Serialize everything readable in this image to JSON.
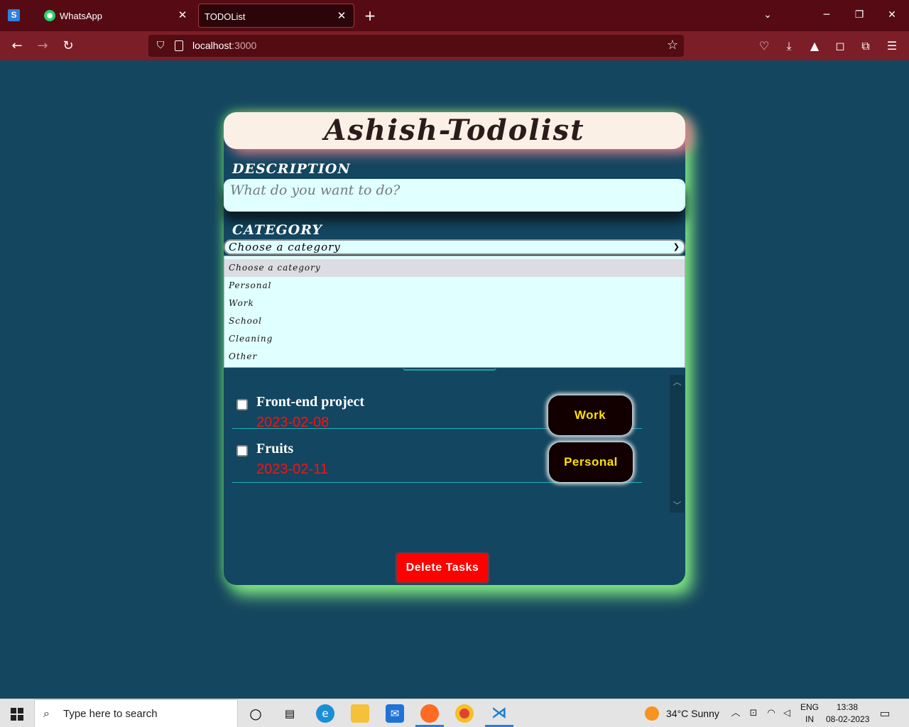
{
  "browser": {
    "tabs": [
      {
        "label": "WhatsApp"
      },
      {
        "label": "TODOList"
      }
    ],
    "url_host": "localhost",
    "url_port": ":3000"
  },
  "app": {
    "title": "Ashish-Todolist",
    "description_label": "DESCRIPTION",
    "description_placeholder": "What do you want to do?",
    "category_label": "CATEGORY",
    "category_selected": "Choose a category",
    "category_options": [
      "Choose a category",
      "Personal",
      "Work",
      "School",
      "Cleaning",
      "Other"
    ],
    "tasks": [
      {
        "name": "Front-end project",
        "date": "2023-02-08",
        "category": "Work"
      },
      {
        "name": "Fruits",
        "date": "2023-02-11",
        "category": "Personal"
      }
    ],
    "delete_label": "Delete Tasks"
  },
  "taskbar": {
    "search_placeholder": "Type here to search",
    "weather": "34°C  Sunny",
    "lang_top": "ENG",
    "lang_bottom": "IN",
    "time": "13:38",
    "date": "08-02-2023"
  },
  "colors": {
    "page_bg": "#15465f",
    "tab_bar": "#560b14",
    "nav_bar": "#7b1e27",
    "card_glow": "#7ce27f",
    "task_date": "#ff1010",
    "category_text": "#ffe100",
    "delete_bg": "#ff0000"
  }
}
